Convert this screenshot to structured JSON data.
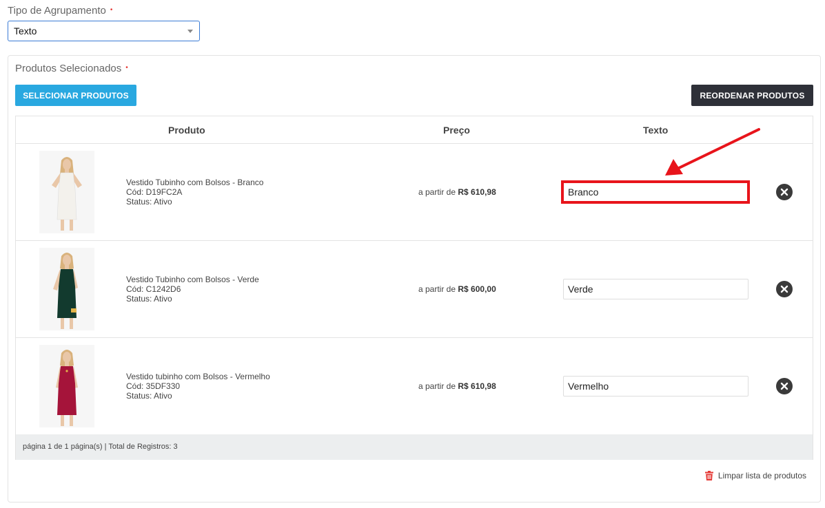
{
  "grouping": {
    "label": "Tipo de Agrupamento",
    "required_mark": "•",
    "selected": "Texto"
  },
  "products_panel": {
    "title": "Produtos Selecionados",
    "required_mark": "•",
    "select_button": "SELECIONAR PRODUTOS",
    "reorder_button": "REORDENAR PRODUTOS"
  },
  "table": {
    "headers": [
      "Produto",
      "Preço",
      "Texto"
    ],
    "rows": [
      {
        "name": "Vestido Tubinho com Bolsos - Branco",
        "code": "Cód: D19FC2A",
        "status": "Status: Ativo",
        "price_prefix": "a partir de",
        "price": "R$ 610,98",
        "text": "Branco",
        "image": "white-dress-model",
        "dress_color": "#f3f1ec"
      },
      {
        "name": "Vestido Tubinho com Bolsos - Verde",
        "code": "Cód: C1242D6",
        "status": "Status: Ativo",
        "price_prefix": "a partir de",
        "price": "R$ 600,00",
        "text": "Verde",
        "image": "green-dress-model",
        "dress_color": "#123a2e"
      },
      {
        "name": "Vestido tubinho com Bolsos - Vermelho",
        "code": "Cód: 35DF330",
        "status": "Status: Ativo",
        "price_prefix": "a partir de",
        "price": "R$ 610,98",
        "text": "Vermelho",
        "image": "red-dress-model",
        "dress_color": "#a5143a"
      }
    ],
    "footer": "página 1 de 1 página(s) | Total de Registros: 3"
  },
  "clear_list": "Limpar lista de produtos",
  "colors": {
    "primary_button": "#29a8e0",
    "dark_button": "#2e3038",
    "annotation_red": "#e8141b",
    "trash_red": "#e53935"
  }
}
